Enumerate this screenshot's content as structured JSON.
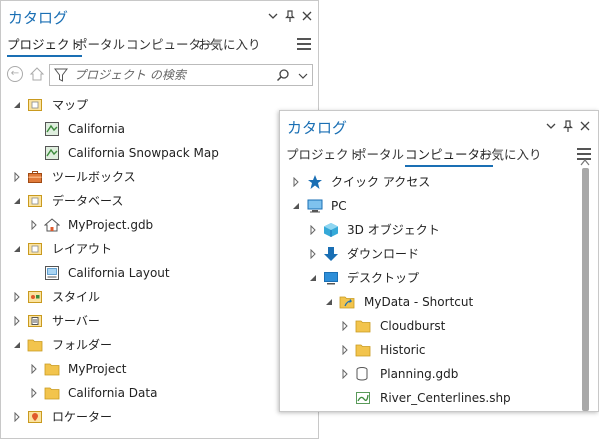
{
  "back_pane": {
    "title": "カタログ",
    "tabs": [
      {
        "label": "プロジェクト",
        "active": true
      },
      {
        "label": "ポータル",
        "active": false
      },
      {
        "label": "コンピューター",
        "active": false
      },
      {
        "label": "お気に入り",
        "active": false
      }
    ],
    "search_placeholder": "プロジェクト の検索",
    "tree": [
      {
        "label": "マップ",
        "icon": "map-folder-icon",
        "expanded": true
      },
      {
        "label": "California",
        "icon": "map-icon"
      },
      {
        "label": "California Snowpack Map",
        "icon": "map-icon"
      },
      {
        "label": "ツールボックス",
        "icon": "toolbox-folder-icon",
        "expanded": false
      },
      {
        "label": "データベース",
        "icon": "database-folder-icon",
        "expanded": true
      },
      {
        "label": "MyProject.gdb",
        "icon": "geodatabase-home-icon",
        "expanded": false
      },
      {
        "label": "レイアウト",
        "icon": "layout-folder-icon",
        "expanded": true
      },
      {
        "label": "California Layout",
        "icon": "layout-icon"
      },
      {
        "label": "スタイル",
        "icon": "style-folder-icon",
        "expanded": false
      },
      {
        "label": "サーバー",
        "icon": "server-folder-icon",
        "expanded": false
      },
      {
        "label": "フォルダー",
        "icon": "folder-folder-icon",
        "expanded": true
      },
      {
        "label": "MyProject",
        "icon": "folder-home-icon",
        "expanded": false
      },
      {
        "label": "California Data",
        "icon": "folder-icon",
        "expanded": false
      },
      {
        "label": "ロケーター",
        "icon": "locator-folder-icon",
        "expanded": false
      }
    ]
  },
  "front_pane": {
    "title": "カタログ",
    "tabs": [
      {
        "label": "プロジェクト",
        "active": false
      },
      {
        "label": "ポータル",
        "active": false
      },
      {
        "label": "コンピューター",
        "active": true
      },
      {
        "label": "お気に入り",
        "active": false
      }
    ],
    "tree": [
      {
        "label": "クイック アクセス",
        "icon": "quick-access-star-icon",
        "expanded": false
      },
      {
        "label": "PC",
        "icon": "pc-monitor-icon",
        "expanded": true
      },
      {
        "label": "3D オブジェクト",
        "icon": "3d-objects-icon",
        "expanded": false
      },
      {
        "label": "ダウンロード",
        "icon": "download-arrow-icon",
        "expanded": false
      },
      {
        "label": "デスクトップ",
        "icon": "desktop-icon",
        "expanded": true
      },
      {
        "label": "MyData - Shortcut",
        "icon": "folder-shortcut-icon",
        "expanded": true
      },
      {
        "label": "Cloudburst",
        "icon": "folder-icon",
        "expanded": false
      },
      {
        "label": "Historic",
        "icon": "folder-icon",
        "expanded": false
      },
      {
        "label": "Planning.gdb",
        "icon": "geodatabase-icon",
        "expanded": false
      },
      {
        "label": "River_Centerlines.shp",
        "icon": "shapefile-line-icon"
      }
    ]
  },
  "colors": {
    "accent": "#1a6fb4",
    "folder": "#f2c44d",
    "border": "#c8c8c8"
  }
}
